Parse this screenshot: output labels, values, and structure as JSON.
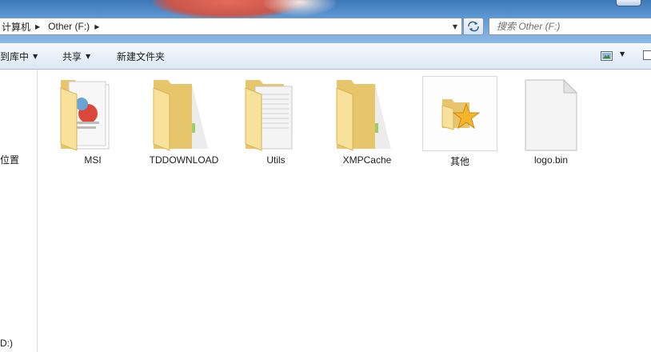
{
  "address_bar": {
    "breadcrumbs": [
      {
        "label": "计算机"
      },
      {
        "label": "Other (F:)"
      }
    ]
  },
  "search": {
    "placeholder": "搜索 Other (F:)"
  },
  "toolbar": {
    "include_in_library_label": "到库中",
    "share_label": "共享",
    "new_folder_label": "新建文件夹"
  },
  "nav_pane": {
    "items": [
      {
        "label": "位置"
      },
      {
        "label": "D:)"
      }
    ]
  },
  "files": [
    {
      "name": "MSI",
      "type": "folder",
      "icon": "folder-with-documents-icon"
    },
    {
      "name": "TDDOWNLOAD",
      "type": "folder",
      "icon": "folder-icon"
    },
    {
      "name": "Utils",
      "type": "folder",
      "icon": "folder-with-paper-icon"
    },
    {
      "name": "XMPCache",
      "type": "folder",
      "icon": "folder-icon"
    },
    {
      "name": "其他",
      "type": "folder",
      "icon": "favorites-folder-star-icon"
    },
    {
      "name": "logo.bin",
      "type": "file",
      "icon": "blank-file-icon"
    }
  ],
  "colors": {
    "folder_light": "#f8e29b",
    "folder_dark": "#e7c56a",
    "toolbar_top": "#f6fafd",
    "toolbar_bottom": "#dce7f4",
    "aero_blue": "#5d98d4",
    "border_blue": "#7a96bd"
  }
}
